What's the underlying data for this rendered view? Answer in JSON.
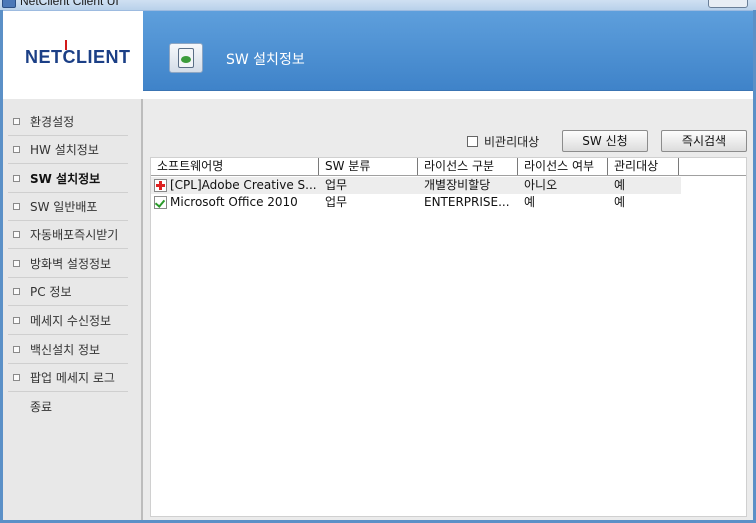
{
  "window": {
    "title": "NetClient Client UI"
  },
  "header": {
    "logo": "NETCLIENT",
    "title": "SW 설치정보"
  },
  "sidebar": {
    "items": [
      {
        "label": "환경설정"
      },
      {
        "label": "HW 설치정보"
      },
      {
        "label": "SW 설치정보",
        "active": true
      },
      {
        "label": "SW 일반배포"
      },
      {
        "label": "자동배포즉시받기"
      },
      {
        "label": "방화벽 설정정보"
      },
      {
        "label": "PC 정보"
      },
      {
        "label": "메세지 수신정보"
      },
      {
        "label": "백신설치 정보"
      },
      {
        "label": "팝업 메세지 로그"
      },
      {
        "label": "종료"
      }
    ]
  },
  "toolbar": {
    "unmanaged_label": "비관리대상",
    "sw_request_label": "SW 신청",
    "instant_search_label": "즉시검색"
  },
  "table": {
    "columns": [
      "소프트웨어명",
      "SW 분류",
      "라이선스 구분",
      "라이선스 여부",
      "관리대상"
    ],
    "rows": [
      {
        "icon": "red-cross-icon",
        "name": "[CPL]Adobe Creative S...",
        "category": "업무",
        "license_type": "개별장비할당",
        "licensed": "아니오",
        "managed": "예"
      },
      {
        "icon": "green-check-icon",
        "name": "Microsoft Office 2010",
        "category": "업무",
        "license_type": "ENTERPRISE...",
        "licensed": "예",
        "managed": "예"
      }
    ]
  }
}
